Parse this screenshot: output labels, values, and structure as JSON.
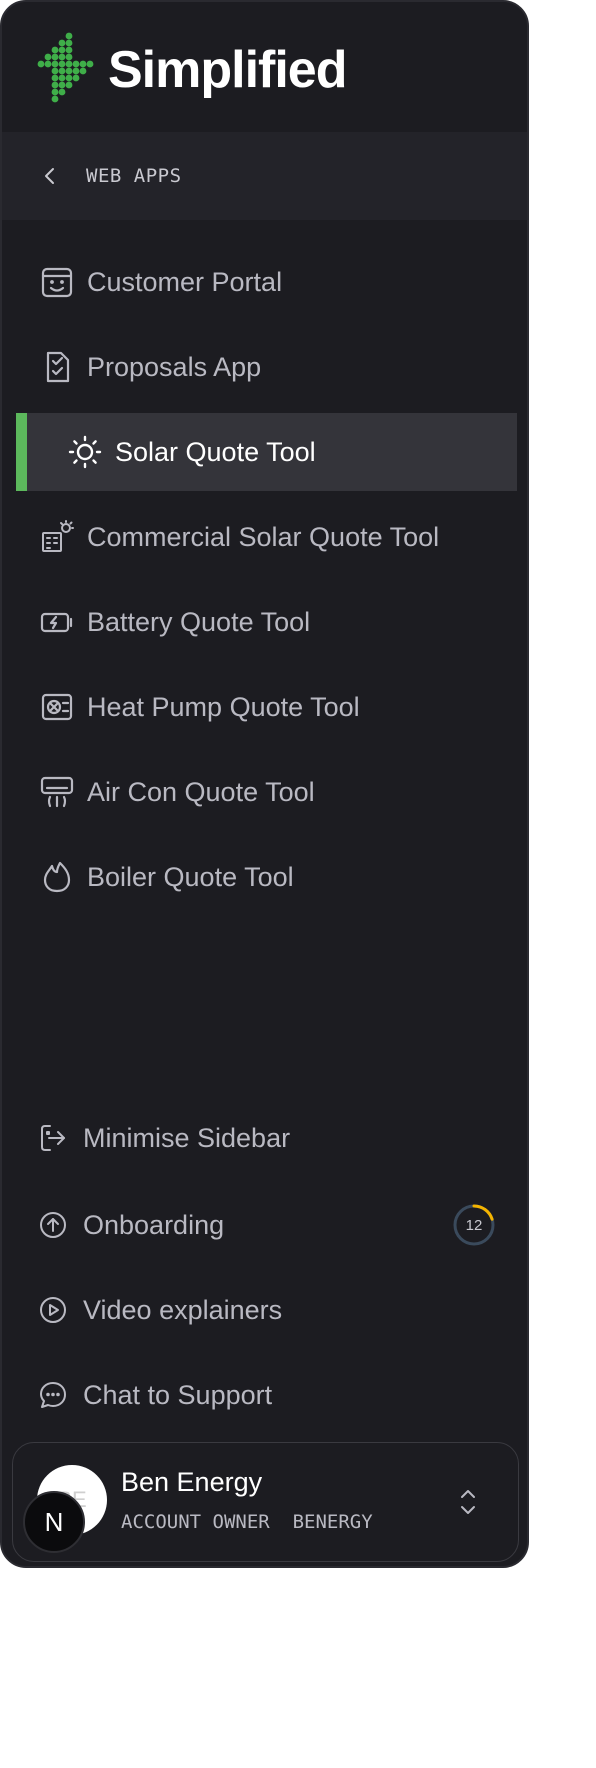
{
  "brand": {
    "name": "Simplified",
    "accent": "#5cb85c"
  },
  "section": {
    "label": "WEB APPS"
  },
  "nav": {
    "items": [
      {
        "label": "Customer Portal",
        "icon": "smile-calendar-icon",
        "active": false
      },
      {
        "label": "Proposals App",
        "icon": "clipboard-check-icon",
        "active": false
      },
      {
        "label": "Solar Quote Tool",
        "icon": "sun-icon",
        "active": true
      },
      {
        "label": "Commercial Solar Quote Tool",
        "icon": "building-sun-icon",
        "active": false
      },
      {
        "label": "Battery Quote Tool",
        "icon": "battery-charging-icon",
        "active": false
      },
      {
        "label": "Heat Pump Quote Tool",
        "icon": "heat-pump-icon",
        "active": false
      },
      {
        "label": "Air Con Quote Tool",
        "icon": "air-conditioner-icon",
        "active": false
      },
      {
        "label": "Boiler Quote Tool",
        "icon": "flame-icon",
        "active": false
      }
    ]
  },
  "footer": {
    "minimise": "Minimise Sidebar",
    "onboarding": "Onboarding",
    "onboarding_count": "12",
    "onboarding_progress": 0.2,
    "video": "Video explainers",
    "support": "Chat to Support"
  },
  "account": {
    "initials": "BE",
    "badge": "N",
    "name": "Ben Energy",
    "role": "ACCOUNT OWNER",
    "org": "BENERGY"
  }
}
